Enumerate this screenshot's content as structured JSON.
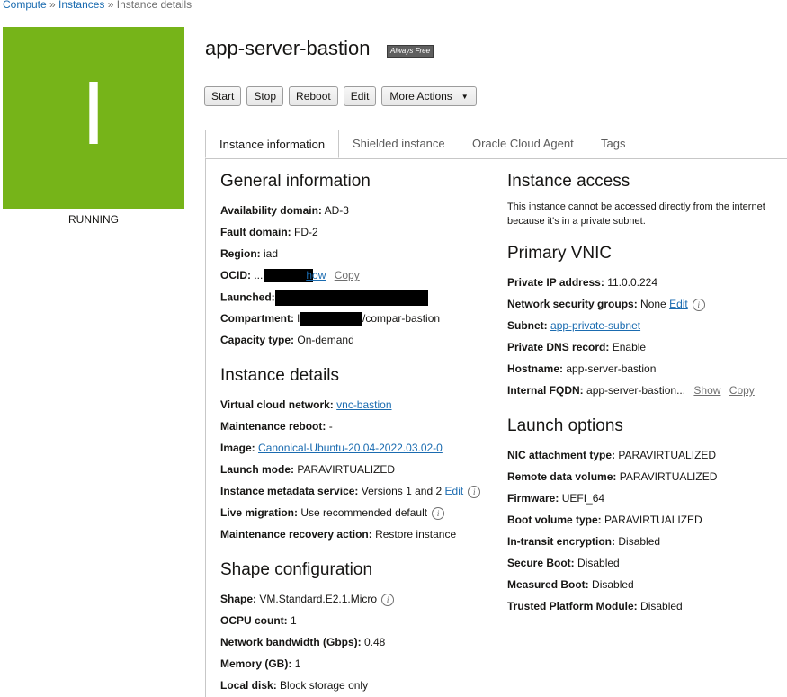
{
  "breadcrumb": {
    "compute": "Compute",
    "sep1": " » ",
    "instances": "Instances",
    "sep2": " » ",
    "current": "Instance details"
  },
  "status": {
    "letter": "I",
    "label": "RUNNING",
    "tile_color": "#76b419"
  },
  "instance": {
    "name": "app-server-bastion",
    "badge": "Always Free"
  },
  "actions": {
    "start": "Start",
    "stop": "Stop",
    "reboot": "Reboot",
    "edit": "Edit",
    "more": "More Actions"
  },
  "tabs": [
    {
      "label": "Instance information"
    },
    {
      "label": "Shielded instance"
    },
    {
      "label": "Oracle Cloud Agent"
    },
    {
      "label": "Tags"
    }
  ],
  "general": {
    "title": "General information",
    "availability_domain": {
      "label": "Availability domain:",
      "value": "AD-3"
    },
    "fault_domain": {
      "label": "Fault domain:",
      "value": "FD-2"
    },
    "region": {
      "label": "Region:",
      "value": "iad"
    },
    "ocid": {
      "label": "OCID:",
      "prefix": "...",
      "show": "Show",
      "copy": "Copy"
    },
    "launched": {
      "label": "Launched:"
    },
    "compartment": {
      "label": "Compartment:",
      "prefix": "l",
      "suffix": "/compar-bastion"
    },
    "capacity_type": {
      "label": "Capacity type:",
      "value": "On-demand"
    }
  },
  "details": {
    "title": "Instance details",
    "vcn": {
      "label": "Virtual cloud network:",
      "value": "vnc-bastion"
    },
    "maintenance_reboot": {
      "label": "Maintenance reboot:",
      "value": "-"
    },
    "image": {
      "label": "Image:",
      "value": "Canonical-Ubuntu-20.04-2022.03.02-0"
    },
    "launch_mode": {
      "label": "Launch mode:",
      "value": "PARAVIRTUALIZED"
    },
    "metadata_service": {
      "label": "Instance metadata service:",
      "value": "Versions 1 and 2",
      "edit": "Edit"
    },
    "live_migration": {
      "label": "Live migration:",
      "value": "Use recommended default"
    },
    "maintenance_recovery": {
      "label": "Maintenance recovery action:",
      "value": "Restore instance"
    }
  },
  "shape": {
    "title": "Shape configuration",
    "shape": {
      "label": "Shape:",
      "value": "VM.Standard.E2.1.Micro"
    },
    "ocpu": {
      "label": "OCPU count:",
      "value": "1"
    },
    "bandwidth": {
      "label": "Network bandwidth (Gbps):",
      "value": "0.48"
    },
    "memory": {
      "label": "Memory (GB):",
      "value": "1"
    },
    "local_disk": {
      "label": "Local disk:",
      "value": "Block storage only"
    }
  },
  "access": {
    "title": "Instance access",
    "text": "This instance cannot be accessed directly from the internet because it's in a private subnet."
  },
  "vnic": {
    "title": "Primary VNIC",
    "private_ip": {
      "label": "Private IP address:",
      "value": "11.0.0.224"
    },
    "nsg": {
      "label": "Network security groups:",
      "value": "None",
      "edit": "Edit"
    },
    "subnet": {
      "label": "Subnet:",
      "value": "app-private-subnet"
    },
    "dns_record": {
      "label": "Private DNS record:",
      "value": "Enable"
    },
    "hostname": {
      "label": "Hostname:",
      "value": "app-server-bastion"
    },
    "fqdn": {
      "label": "Internal FQDN:",
      "value": "app-server-bastion...",
      "show": "Show",
      "copy": "Copy"
    }
  },
  "launch_options": {
    "title": "Launch options",
    "nic_attachment": {
      "label": "NIC attachment type:",
      "value": "PARAVIRTUALIZED"
    },
    "remote_volume": {
      "label": "Remote data volume:",
      "value": "PARAVIRTUALIZED"
    },
    "firmware": {
      "label": "Firmware:",
      "value": "UEFI_64"
    },
    "boot_volume": {
      "label": "Boot volume type:",
      "value": "PARAVIRTUALIZED"
    },
    "in_transit": {
      "label": "In-transit encryption:",
      "value": "Disabled"
    },
    "secure_boot": {
      "label": "Secure Boot:",
      "value": "Disabled"
    },
    "measured_boot": {
      "label": "Measured Boot:",
      "value": "Disabled"
    },
    "tpm": {
      "label": "Trusted Platform Module:",
      "value": "Disabled"
    }
  }
}
